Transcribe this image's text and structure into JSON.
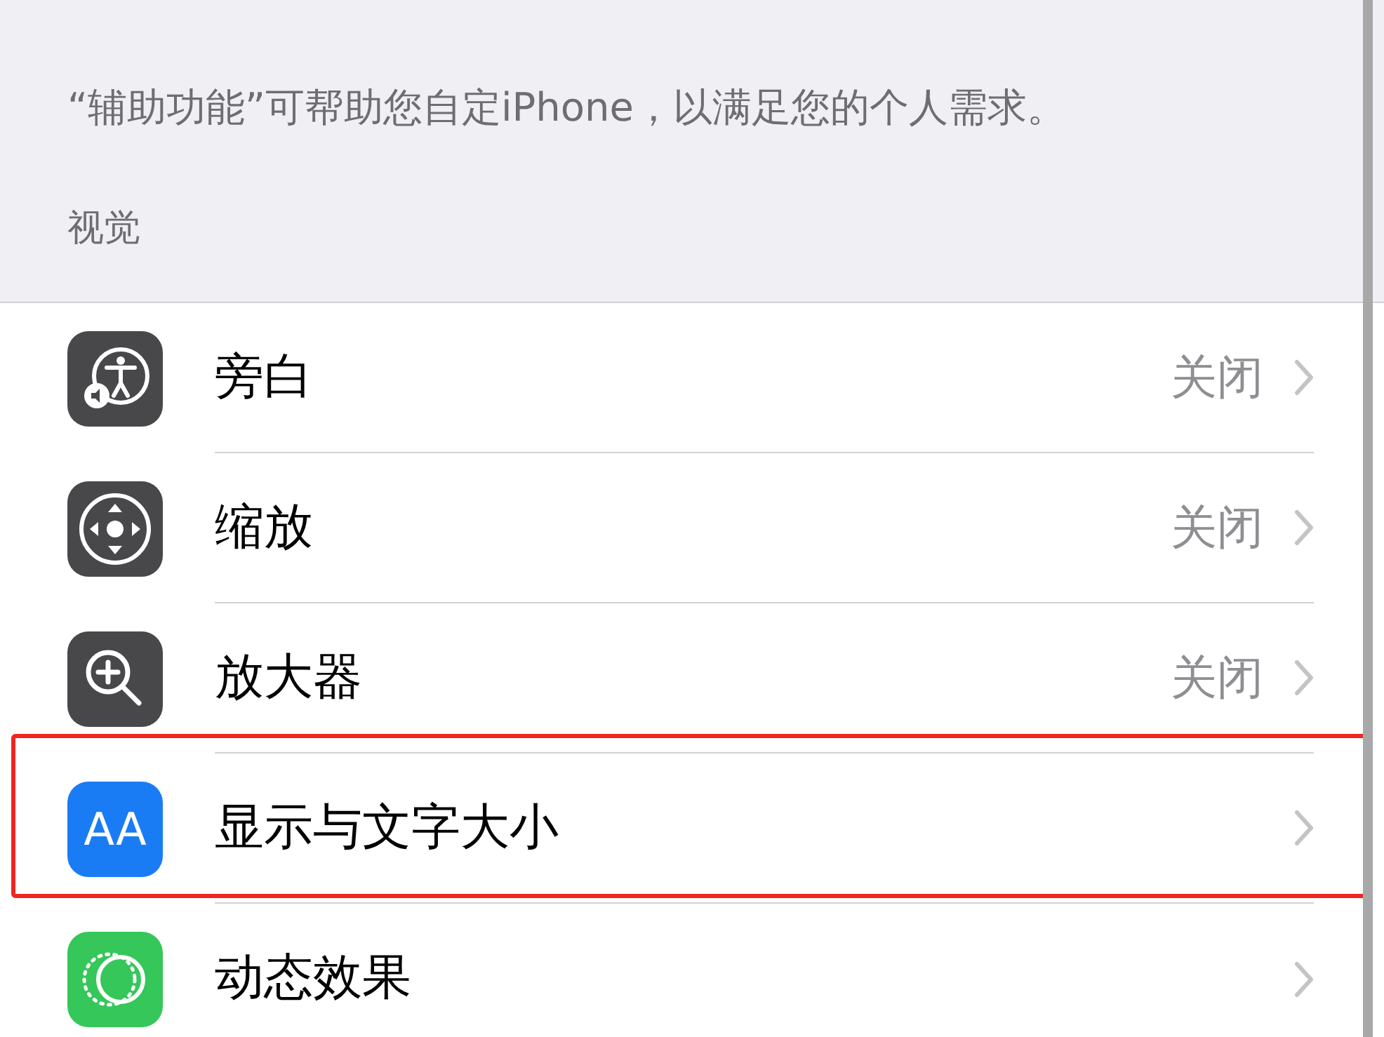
{
  "description": "“辅助功能”可帮助您自定iPhone，以满足您的个人需求。",
  "section_header": "视觉",
  "items": [
    {
      "kind": "voiceover",
      "label": "旁白",
      "value": "关闭",
      "highlighted": false
    },
    {
      "kind": "zoom",
      "label": "缩放",
      "value": "关闭",
      "highlighted": false
    },
    {
      "kind": "magnifier",
      "label": "放大器",
      "value": "关闭",
      "highlighted": false
    },
    {
      "kind": "display_text",
      "label": "显示与文字大小",
      "icon_text": "AA",
      "highlighted": true
    },
    {
      "kind": "motion",
      "label": "动态效果",
      "highlighted": false
    }
  ]
}
